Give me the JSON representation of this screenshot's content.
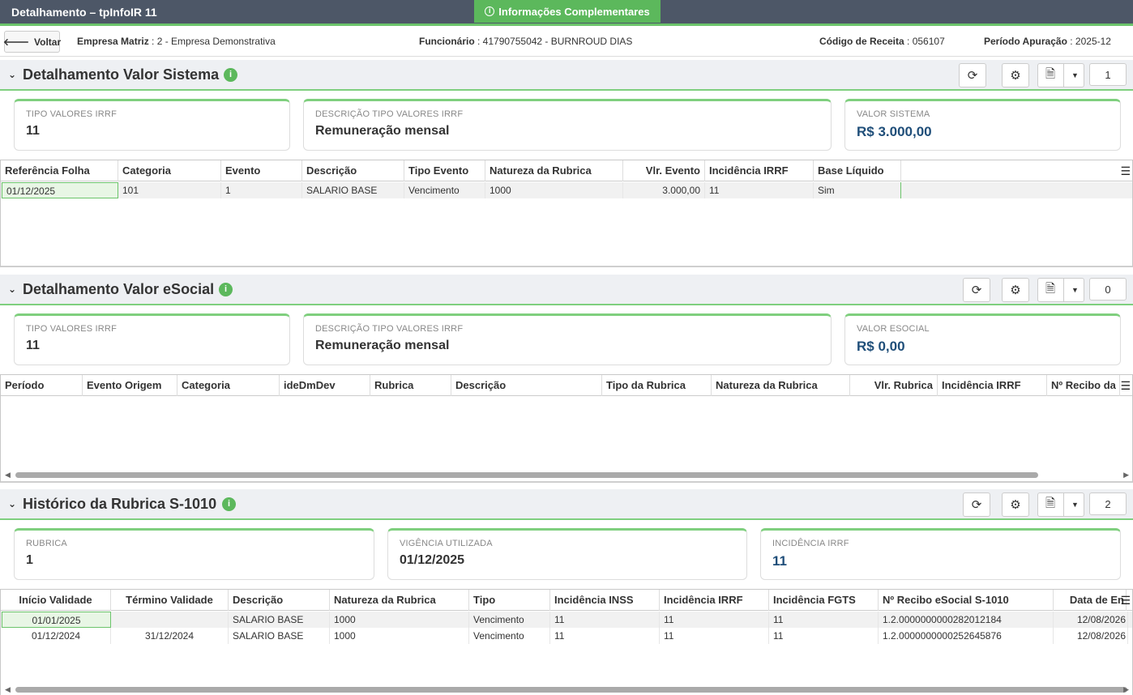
{
  "header": {
    "title": "Detalhamento – tpInfoIR 11",
    "info_button": "Informações Complementares"
  },
  "subheader": {
    "back_label": "Voltar",
    "empresa_label": "Empresa Matriz",
    "empresa_value": ": 2 - Empresa Demonstrativa",
    "funcionario_label": "Funcionário",
    "funcionario_value": ": 41790755042 - BURNROUD DIAS",
    "codigo_label": "Código de Receita",
    "codigo_value": ": 056107",
    "periodo_label": "Período Apuração",
    "periodo_value": ": 2025-12"
  },
  "section1": {
    "title": "Detalhamento Valor Sistema",
    "count": "1",
    "cards": [
      {
        "label": "TIPO VALORES IRRF",
        "value": "11"
      },
      {
        "label": "DESCRIÇÃO TIPO VALORES IRRF",
        "value": "Remuneração mensal"
      },
      {
        "label": "VALOR SISTEMA",
        "value": "R$ 3.000,00"
      }
    ],
    "columns": [
      "Referência Folha",
      "Categoria",
      "Evento",
      "Descrição",
      "Tipo Evento",
      "Natureza da Rubrica",
      "Vlr. Evento",
      "Incidência IRRF",
      "Base Líquido"
    ],
    "rows": [
      [
        "01/12/2025",
        "101",
        "1",
        "SALARIO BASE",
        "Vencimento",
        "1000",
        "3.000,00",
        "11",
        "Sim"
      ]
    ]
  },
  "section2": {
    "title": "Detalhamento Valor eSocial",
    "count": "0",
    "cards": [
      {
        "label": "TIPO VALORES IRRF",
        "value": "11"
      },
      {
        "label": "DESCRIÇÃO TIPO VALORES IRRF",
        "value": "Remuneração mensal"
      },
      {
        "label": "VALOR ESOCIAL",
        "value": "R$ 0,00"
      }
    ],
    "columns": [
      "Período",
      "Evento Origem",
      "Categoria",
      "ideDmDev",
      "Rubrica",
      "Descrição",
      "Tipo da Rubrica",
      "Natureza da Rubrica",
      "Vlr. Rubrica",
      "Incidência IRRF",
      "Nº Recibo da"
    ]
  },
  "section3": {
    "title": "Histórico da Rubrica S-1010",
    "count": "2",
    "cards": [
      {
        "label": "RUBRICA",
        "value": "1"
      },
      {
        "label": "VIGÊNCIA UTILIZADA",
        "value": "01/12/2025"
      },
      {
        "label": "INCIDÊNCIA IRRF",
        "value": "11"
      }
    ],
    "columns": [
      "Início Validade",
      "Término Validade",
      "Descrição",
      "Natureza da Rubrica",
      "Tipo",
      "Incidência INSS",
      "Incidência IRRF",
      "Incidência FGTS",
      "Nº Recibo eSocial S-1010",
      "Data de En"
    ],
    "rows": [
      [
        "01/01/2025",
        "",
        "SALARIO BASE",
        "1000",
        "Vencimento",
        "11",
        "11",
        "11",
        "1.2.0000000000282012184",
        "12/08/2026"
      ],
      [
        "01/12/2024",
        "31/12/2024",
        "SALARIO BASE",
        "1000",
        "Vencimento",
        "11",
        "11",
        "11",
        "1.2.0000000000252645876",
        "12/08/2026"
      ]
    ]
  }
}
